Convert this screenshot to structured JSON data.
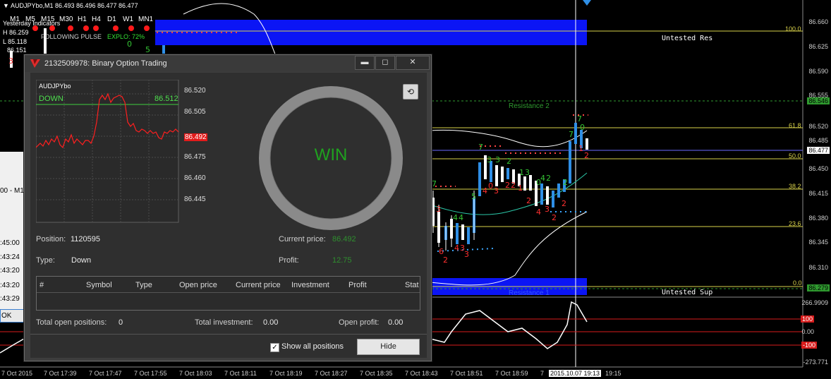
{
  "chart": {
    "symbol_info": "AUDJPYbo,M1  86.493 86.496 86.477 86.477",
    "timeframes": [
      "M1",
      "M5",
      "M15",
      "M30",
      "H1",
      "H4",
      "D1",
      "W1",
      "MN1"
    ],
    "indicator_lines": [
      "Yesterday Indicators",
      "H 86.259",
      "FOLLOWING PULSE",
      "EXPLO: 72%",
      "L 85.118",
      "86.151"
    ],
    "price_levels": [
      "86.660",
      "86.625",
      "86.590",
      "86.555",
      "86.546",
      "86.520",
      "86.485",
      "86.477",
      "86.450",
      "86.415",
      "86.380",
      "86.345",
      "86.310",
      "86.279"
    ],
    "fib_levels": [
      "100.0",
      "61.8",
      "50.0",
      "38.2",
      "23.6",
      "0.0"
    ],
    "zone_labels": {
      "top": "Untested Res",
      "bottom": "Untested Sup"
    },
    "resistance_labels": [
      "Resistance 2",
      "Resistance 1"
    ],
    "osc_levels": [
      "266.9909",
      "100",
      "0.00",
      "-100",
      "-273.771"
    ],
    "time_labels": [
      "7 Oct 2015",
      "7 Oct 17:39",
      "7 Oct 17:47",
      "7 Oct 17:55",
      "7 Oct 18:03",
      "7 Oct 18:11",
      "7 Oct 18:19",
      "7 Oct 18:27",
      "7 Oct 18:35",
      "7 Oct 18:43",
      "7 Oct 18:51",
      "7 Oct 18:59",
      "7",
      "2015.10.07 19:13",
      "19:15"
    ],
    "colors": {
      "bg": "#000000",
      "zone": "#0b15f5",
      "bull": "#2f8fe6",
      "bear": "#ffffff",
      "fib": "#d9d24a",
      "resistance": "#2f9a2f"
    }
  },
  "bg_window": {
    "lines": [
      "00 - M1",
      ":45:00",
      ":43:24",
      ":43:20",
      ":43:20",
      ":43:29"
    ],
    "ok_label": "OK"
  },
  "dialog": {
    "title": "2132509978: Binary Option Trading",
    "window_buttons": {
      "minimize": "▬",
      "maximize": "◻",
      "close": "✕"
    },
    "mini_chart": {
      "symbol": "AUDJPYbo",
      "direction": "DOWN",
      "entry_price": "86.512",
      "current_price_tag": "86.492",
      "y_ticks": [
        "86.520",
        "86.505",
        "86.490",
        "86.475",
        "86.460",
        "86.445"
      ]
    },
    "result": "WIN",
    "position_label": "Position:",
    "position_value": "1120595",
    "type_label": "Type:",
    "type_value": "Down",
    "current_price_label": "Current price:",
    "current_price_value": "86.492",
    "profit_label": "Profit:",
    "profit_value": "12.75",
    "table_headers": [
      "#",
      "Symbol",
      "Type",
      "Open price",
      "Current price",
      "Investment",
      "Profit",
      "Stat"
    ],
    "total_open_label": "Total open positions:",
    "total_open_value": "0",
    "total_investment_label": "Total investment:",
    "total_investment_value": "0.00",
    "open_profit_label": "Open profit:",
    "open_profit_value": "0.00",
    "show_all_label": "Show all positions",
    "show_all_checked": true,
    "hide_label": "Hide"
  }
}
